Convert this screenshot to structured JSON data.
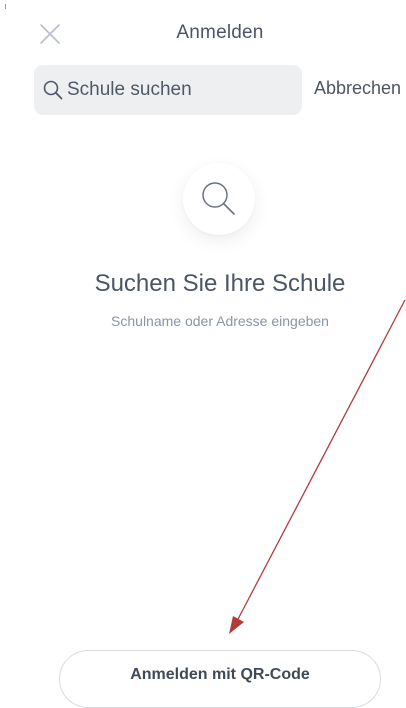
{
  "header": {
    "title": "Anmelden",
    "close_icon": "close-icon"
  },
  "search": {
    "value": "Schule suchen",
    "icon": "search-icon",
    "cancel_label": "Abbrechen"
  },
  "empty_state": {
    "icon": "search-icon",
    "title": "Suchen Sie Ihre Schule",
    "subtitle": "Schulname oder Adresse eingeben"
  },
  "footer": {
    "qr_button_label": "Anmelden mit QR-Code"
  },
  "colors": {
    "text": "#4b5563",
    "muted": "#8a94a3",
    "field_bg": "#eeeff1",
    "annotation": "#b23a3a"
  }
}
